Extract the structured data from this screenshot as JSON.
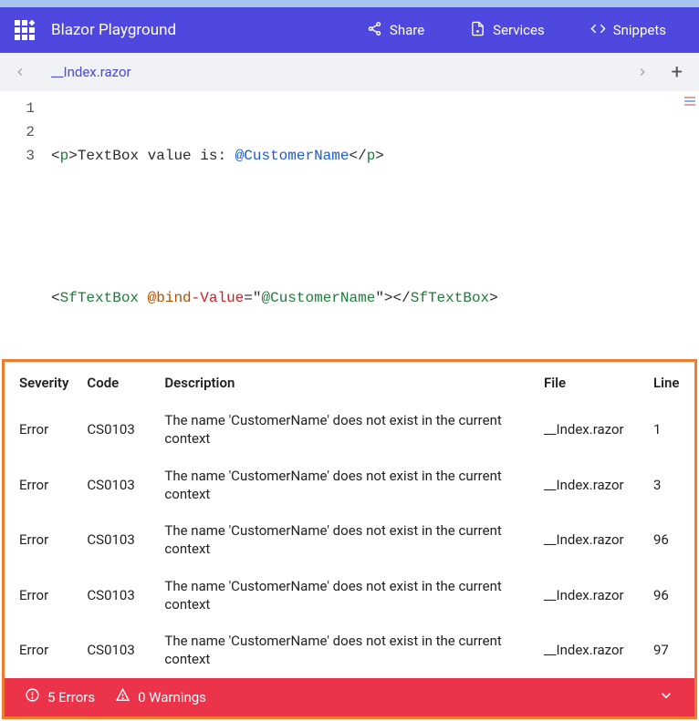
{
  "nav": {
    "brand": "Blazor Playground",
    "share": "Share",
    "services": "Services",
    "snippets": "Snippets"
  },
  "tabs": {
    "file": "__Index.razor"
  },
  "editor": {
    "gutter": [
      "1",
      "2",
      "3"
    ]
  },
  "code": {
    "l1": {
      "o1": "<",
      "tag1": "p",
      "c1": ">",
      "txt1": "TextBox value is: ",
      "at1": "@CustomerName",
      "o2": "</",
      "tag2": "p",
      "c2": ">"
    },
    "l3": {
      "o1": "<",
      "tag1": "SfTextBox",
      "sp": " ",
      "a1": "@bind",
      "a2": "-Value",
      "eq": "=",
      "q1": "\"",
      "str": "@CustomerName",
      "q2": "\"",
      "c1": "></",
      "tag2": "SfTextBox",
      "c2": ">"
    }
  },
  "errors": {
    "headers": {
      "severity": "Severity",
      "code": "Code",
      "description": "Description",
      "file": "File",
      "line": "Line"
    },
    "rows": [
      {
        "severity": "Error",
        "code": "CS0103",
        "description": "The name 'CustomerName' does not exist in the current context",
        "file": "__Index.razor",
        "line": "1"
      },
      {
        "severity": "Error",
        "code": "CS0103",
        "description": "The name 'CustomerName' does not exist in the current context",
        "file": "__Index.razor",
        "line": "3"
      },
      {
        "severity": "Error",
        "code": "CS0103",
        "description": "The name 'CustomerName' does not exist in the current context",
        "file": "__Index.razor",
        "line": "96"
      },
      {
        "severity": "Error",
        "code": "CS0103",
        "description": "The name 'CustomerName' does not exist in the current context",
        "file": "__Index.razor",
        "line": "96"
      },
      {
        "severity": "Error",
        "code": "CS0103",
        "description": "The name 'CustomerName' does not exist in the current context",
        "file": "__Index.razor",
        "line": "97"
      }
    ]
  },
  "status": {
    "errors": "5 Errors",
    "warnings": "0 Warnings"
  }
}
